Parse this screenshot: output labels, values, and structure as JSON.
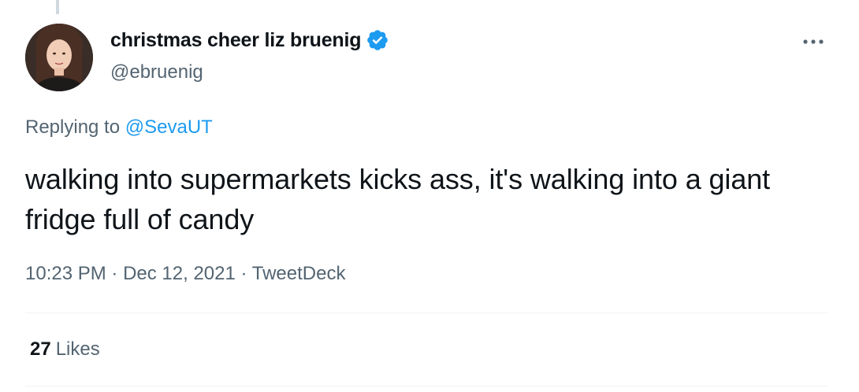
{
  "tweet": {
    "author": {
      "display_name": "christmas cheer liz bruenig",
      "handle": "@ebruenig",
      "verified": true,
      "avatar_icon": "user-avatar"
    },
    "more_icon": "more-icon",
    "reply_context": {
      "prefix": "Replying to",
      "mention": "@SevaUT"
    },
    "text": "walking into supermarkets kicks ass, it's walking into a giant fridge full of candy",
    "time": "10:23 PM",
    "separator": "·",
    "date": "Dec 12, 2021",
    "source": "TweetDeck",
    "likes": {
      "count": "27",
      "label": "Likes"
    }
  },
  "colors": {
    "text_primary": "#0f1419",
    "text_secondary": "#536471",
    "accent": "#1d9bf0",
    "divider": "#eff3f4"
  }
}
